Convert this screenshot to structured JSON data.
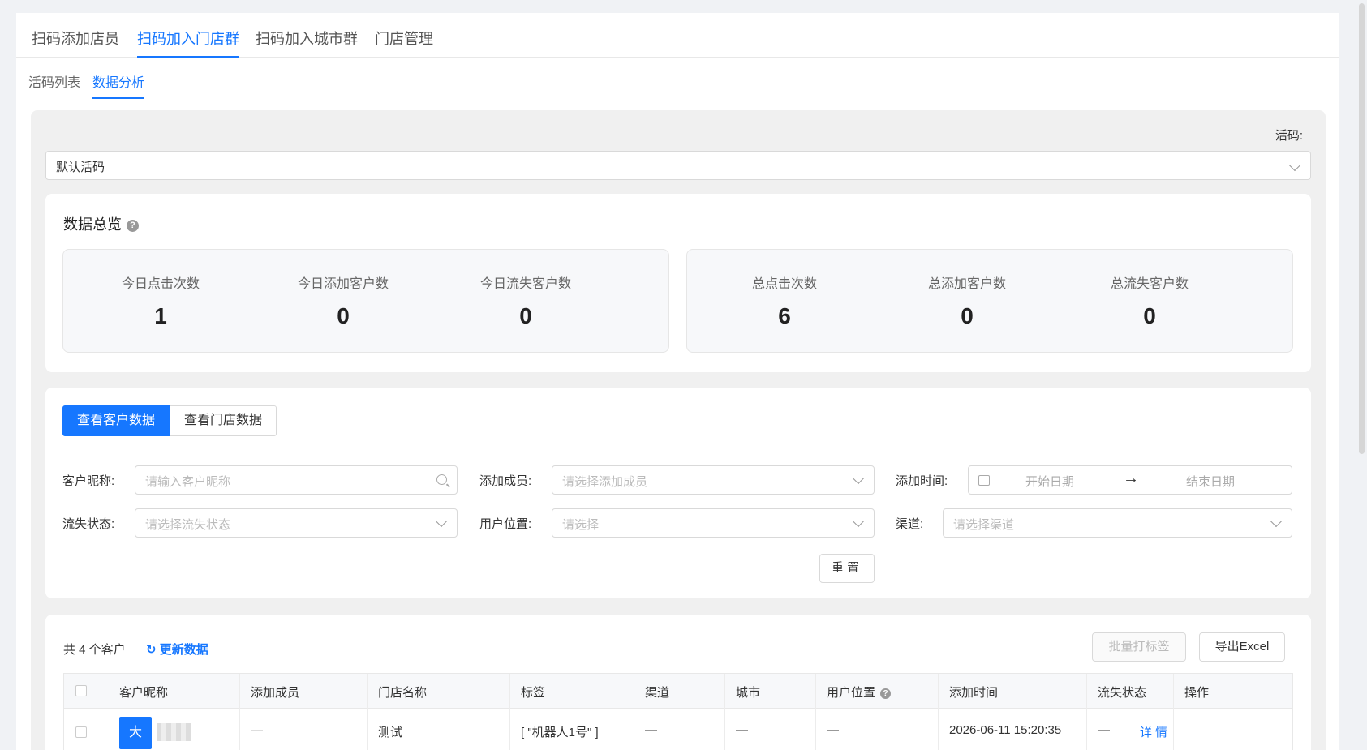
{
  "top_tabs": [
    "扫码添加店员",
    "扫码加入门店群",
    "扫码加入城市群",
    "门店管理"
  ],
  "sub_tabs": [
    "活码列表",
    "数据分析"
  ],
  "code_label": "活码:",
  "code_select_value": "默认活码",
  "overview": {
    "title": "数据总览",
    "help": "?",
    "today": [
      {
        "label": "今日点击次数",
        "value": "1"
      },
      {
        "label": "今日添加客户数",
        "value": "0"
      },
      {
        "label": "今日流失客户数",
        "value": "0"
      }
    ],
    "total": [
      {
        "label": "总点击次数",
        "value": "6"
      },
      {
        "label": "总添加客户数",
        "value": "0"
      },
      {
        "label": "总流失客户数",
        "value": "0"
      }
    ]
  },
  "view_buttons": {
    "customer": "查看客户数据",
    "store": "查看门店数据"
  },
  "filters": {
    "nickname_label": "客户昵称:",
    "nickname_placeholder": "请输入客户昵称",
    "member_label": "添加成员:",
    "member_placeholder": "请选择添加成员",
    "time_label": "添加时间:",
    "start_date": "开始日期",
    "end_date": "结束日期",
    "date_arrow": "→",
    "churn_label": "流失状态:",
    "churn_placeholder": "请选择流失状态",
    "location_label": "用户位置:",
    "location_placeholder": "请选择",
    "channel_label": "渠道:",
    "channel_placeholder": "请选择渠道",
    "reset": "重置"
  },
  "list": {
    "total": "共 4 个客户",
    "refresh": "更新数据",
    "batch_tag": "批量打标签",
    "export": "导出Excel",
    "columns": [
      "客户昵称",
      "添加成员",
      "门店名称",
      "标签",
      "渠道",
      "城市",
      "用户位置",
      "添加时间",
      "流失状态",
      "操作"
    ],
    "rows": [
      {
        "avatar_char": "大",
        "member": "—",
        "store": "测试",
        "tag": "[ \"机器人1号\" ]",
        "channel": "—",
        "city": "—",
        "location": "—",
        "time": "2026-06-11 15:20:35",
        "churn": "—",
        "action": "详情"
      }
    ]
  },
  "colors": {
    "accent": "#1677ff"
  }
}
